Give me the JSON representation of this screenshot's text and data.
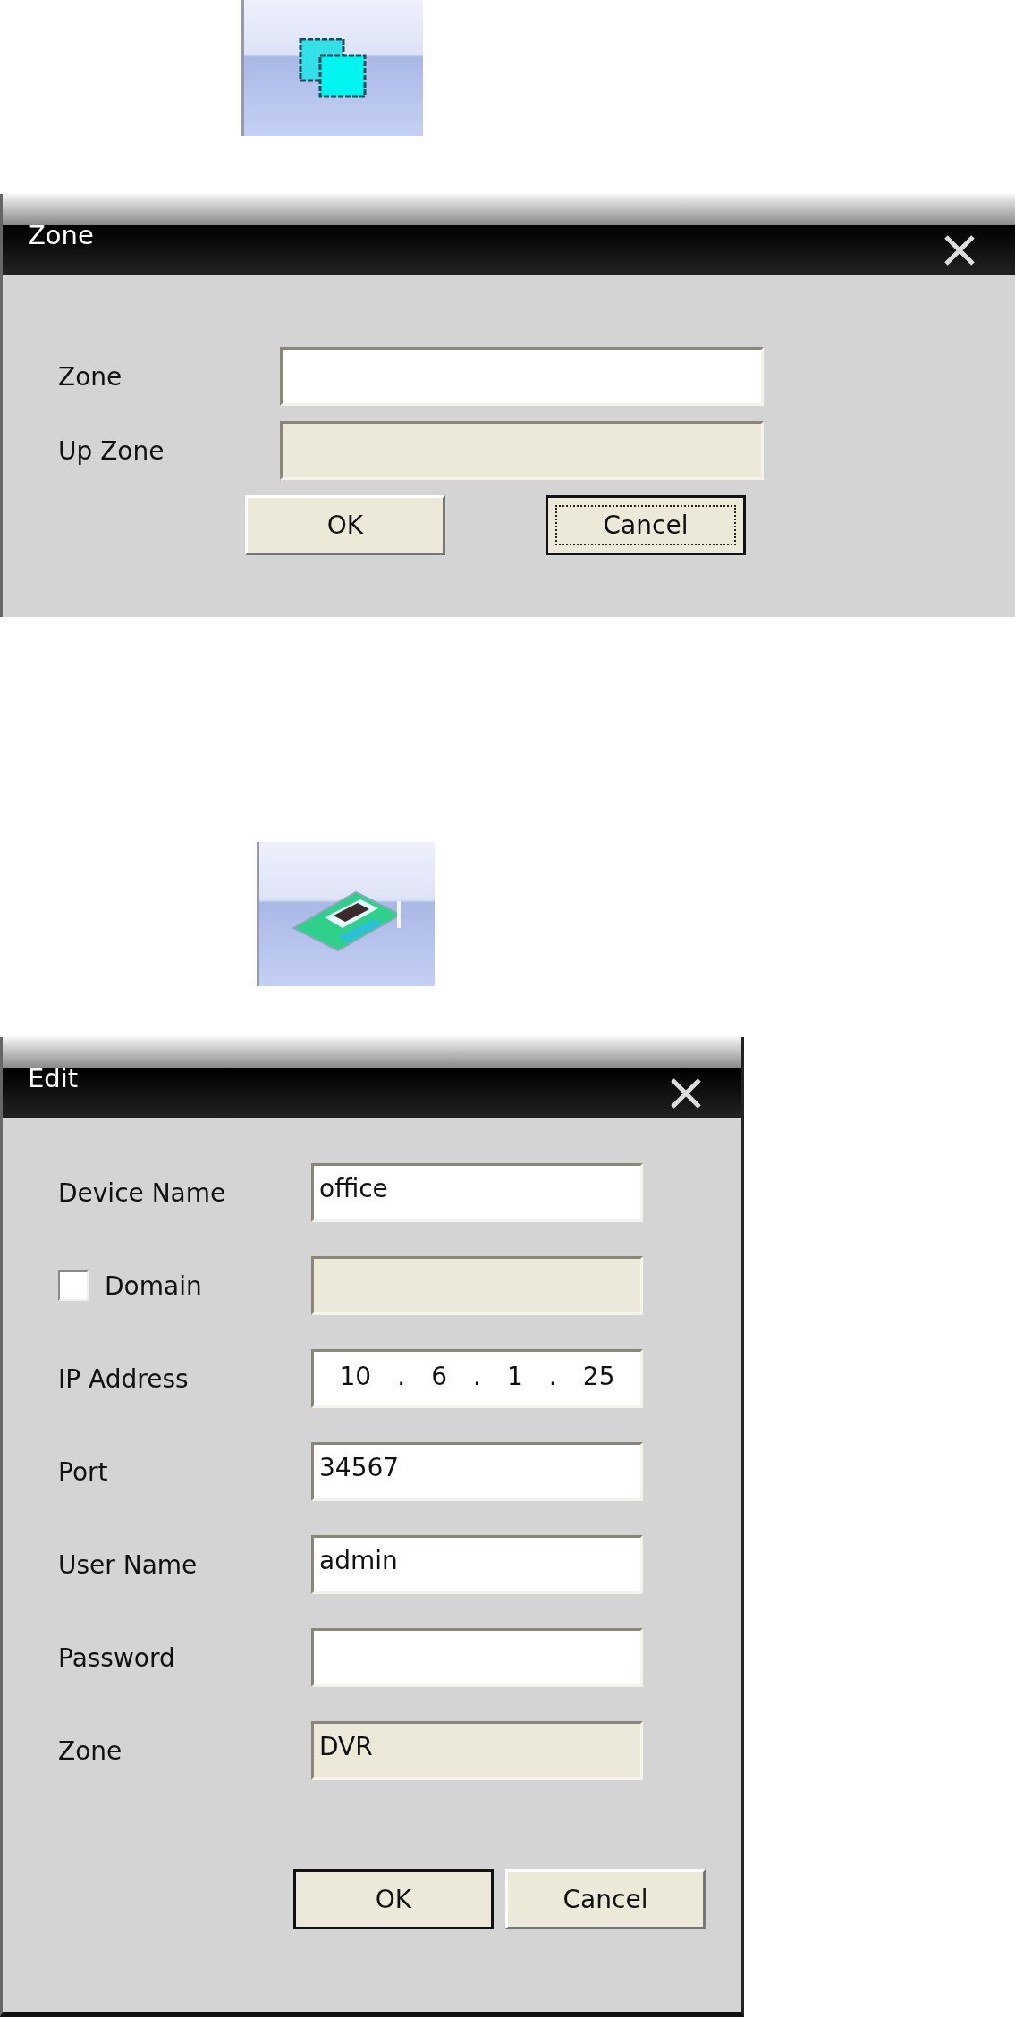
{
  "dialogs": [
    {
      "title": "Zone",
      "fields": [
        {
          "kind": "text",
          "label": "Zone",
          "disabled": false
        },
        {
          "kind": "text",
          "label": "Up Zone",
          "disabled": true
        }
      ],
      "buttons": [
        {
          "label": "OK",
          "default": false,
          "focused": false
        },
        {
          "label": "Cancel",
          "default": true,
          "focused": true
        }
      ]
    },
    {
      "title": "Edit",
      "fields": [
        {
          "kind": "text",
          "label": "Device Name",
          "value": "office",
          "disabled": false
        },
        {
          "kind": "checkbox",
          "label": "Domain",
          "checked": false,
          "disabled": true
        },
        {
          "kind": "ip",
          "label": "IP Address",
          "octets": [
            "10",
            "6",
            "1",
            "25"
          ],
          "separator": "."
        },
        {
          "kind": "text",
          "label": "Port",
          "value": "34567",
          "disabled": false
        },
        {
          "kind": "text",
          "label": "User Name",
          "value": "admin",
          "disabled": false
        },
        {
          "kind": "password",
          "label": "Password",
          "disabled": false
        },
        {
          "kind": "text",
          "label": "Zone",
          "value": "DVR",
          "disabled": true
        }
      ],
      "buttons": [
        {
          "label": "OK",
          "default": true,
          "focused": false
        },
        {
          "label": "Cancel",
          "default": false,
          "focused": false
        }
      ]
    }
  ]
}
